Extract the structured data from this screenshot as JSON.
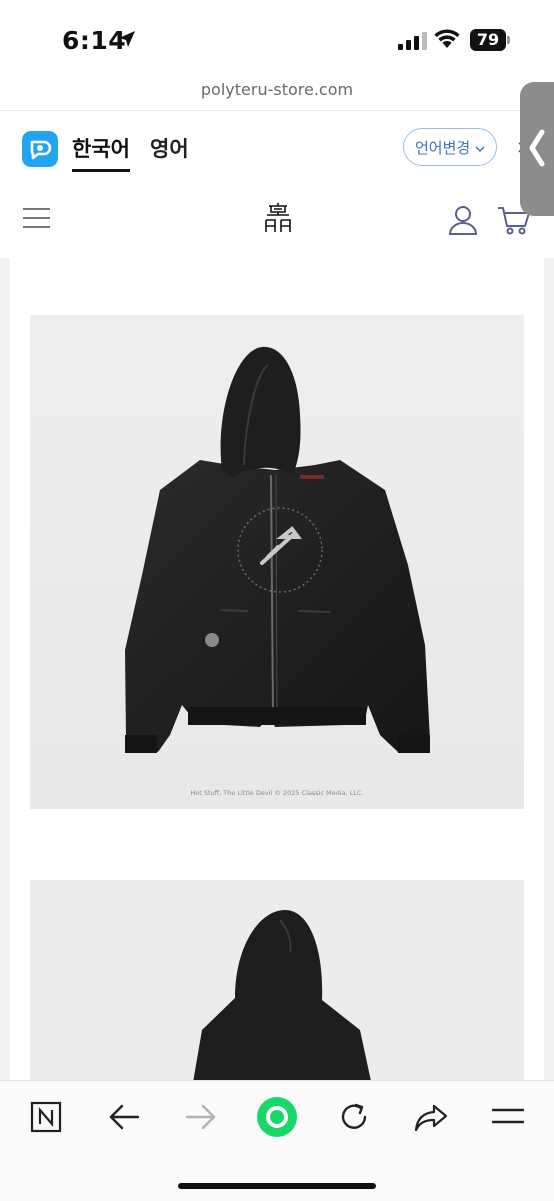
{
  "status_bar": {
    "time": "6:14",
    "battery": "79"
  },
  "browser": {
    "url": "polyteru-store.com"
  },
  "translate_bar": {
    "tabs": [
      {
        "label": "한국어",
        "active": true
      },
      {
        "label": "영어",
        "active": false
      }
    ],
    "change_language_label": "언어변경",
    "close_label": "×"
  },
  "product": {
    "images": [
      {
        "caption": "Hot Stuff, The Little Devil © 2025 Classic Media, LLC."
      },
      {
        "caption": ""
      }
    ]
  },
  "toolbar": {
    "items": [
      "naver-icon",
      "back-icon",
      "forward-icon",
      "green-dot-icon",
      "reload-icon",
      "share-icon",
      "menu-icon"
    ]
  },
  "colors": {
    "accent_blue": "#3b71c8",
    "papago": "#22a4f2",
    "green": "#19d86a"
  }
}
